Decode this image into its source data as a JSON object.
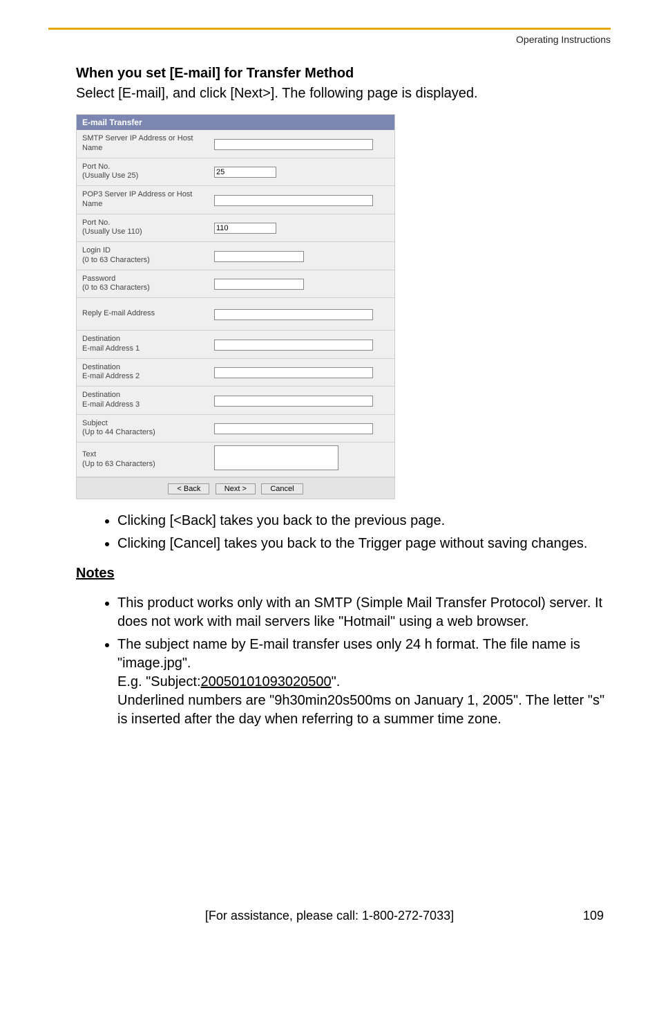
{
  "header": {
    "doc_label": "Operating Instructions"
  },
  "section": {
    "title": "When you set [E-mail] for Transfer Method",
    "lead": "Select [E-mail], and click [Next>]. The following page is displayed."
  },
  "panel": {
    "title": "E-mail Transfer",
    "rows": {
      "smtp_label": "SMTP Server IP Address or Host Name",
      "smtp_value": "",
      "port25_label": "Port No.\n(Usually Use 25)",
      "port25_value": "25",
      "pop3_label": "POP3 Server IP Address or Host Name",
      "pop3_value": "",
      "port110_label": "Port No.\n(Usually Use 110)",
      "port110_value": "110",
      "login_label": "Login ID\n(0 to 63 Characters)",
      "login_value": "",
      "password_label": "Password\n(0 to 63 Characters)",
      "password_value": "",
      "reply_label": "Reply E-mail Address",
      "reply_value": "",
      "dest1_label": "Destination\nE-mail Address 1",
      "dest1_value": "",
      "dest2_label": "Destination\nE-mail Address 2",
      "dest2_value": "",
      "dest3_label": "Destination\nE-mail Address 3",
      "dest3_value": "",
      "subject_label": "Subject\n(Up to 44 Characters)",
      "subject_value": "",
      "text_label": "Text\n(Up to 63 Characters)",
      "text_value": ""
    },
    "buttons": {
      "back": "< Back",
      "next": "Next >",
      "cancel": "Cancel"
    }
  },
  "bullets1": [
    "Clicking [<Back] takes you back to the previous page.",
    "Clicking [Cancel] takes you back to the Trigger page without saving changes."
  ],
  "notes_title": "Notes",
  "bullets2": {
    "item1": "This product works only with an SMTP (Simple Mail Transfer Protocol) server. It does not work with mail servers like \"Hotmail\" using a web browser.",
    "item2_line1": "The subject name by E-mail transfer uses only 24 h format. The file name is \"image.jpg\".",
    "item2_eg_prefix": "E.g. \"Subject:",
    "item2_eg_underlined": "20050101093020500",
    "item2_eg_suffix": "\".",
    "item2_line3": "Underlined numbers are \"9h30min20s500ms on January 1, 2005\". The letter \"s\" is inserted after the day when referring to a summer time zone."
  },
  "footer": {
    "center": "[For assistance, please call: 1-800-272-7033]",
    "page": "109"
  }
}
